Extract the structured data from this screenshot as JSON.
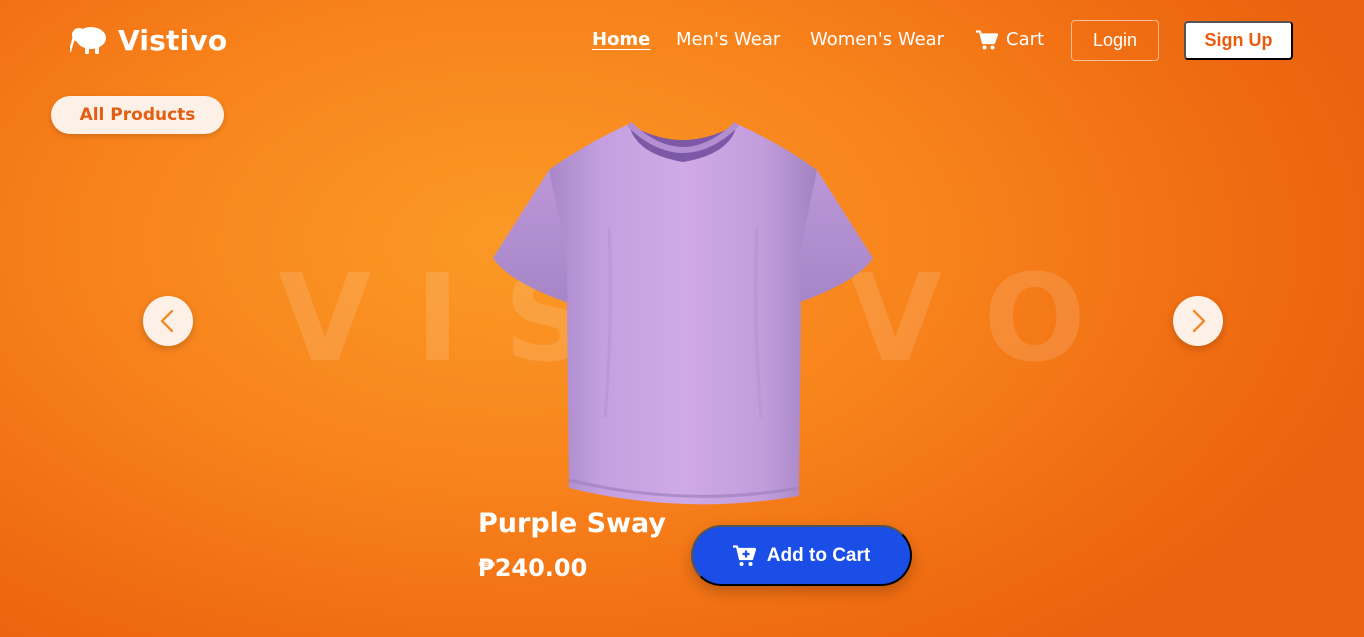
{
  "brand": {
    "name": "Vistivo",
    "logo_icon": "kiwi-bird-icon"
  },
  "nav": {
    "home": "Home",
    "mens": "Men's Wear",
    "womens": "Women's Wear",
    "cart": "Cart",
    "cart_icon": "cart-icon",
    "login": "Login",
    "signup": "Sign Up"
  },
  "filter": {
    "all_products": "All Products"
  },
  "carousel": {
    "watermark": "VISTIVO",
    "prev_icon": "chevron-left-icon",
    "next_icon": "chevron-right-icon"
  },
  "product": {
    "name": "Purple Sway",
    "price": "₱240.00",
    "add_to_cart": "Add to Cart",
    "color": "#c9a3e0"
  },
  "colors": {
    "accent": "#f7861b",
    "cta": "#1a4ee6"
  }
}
